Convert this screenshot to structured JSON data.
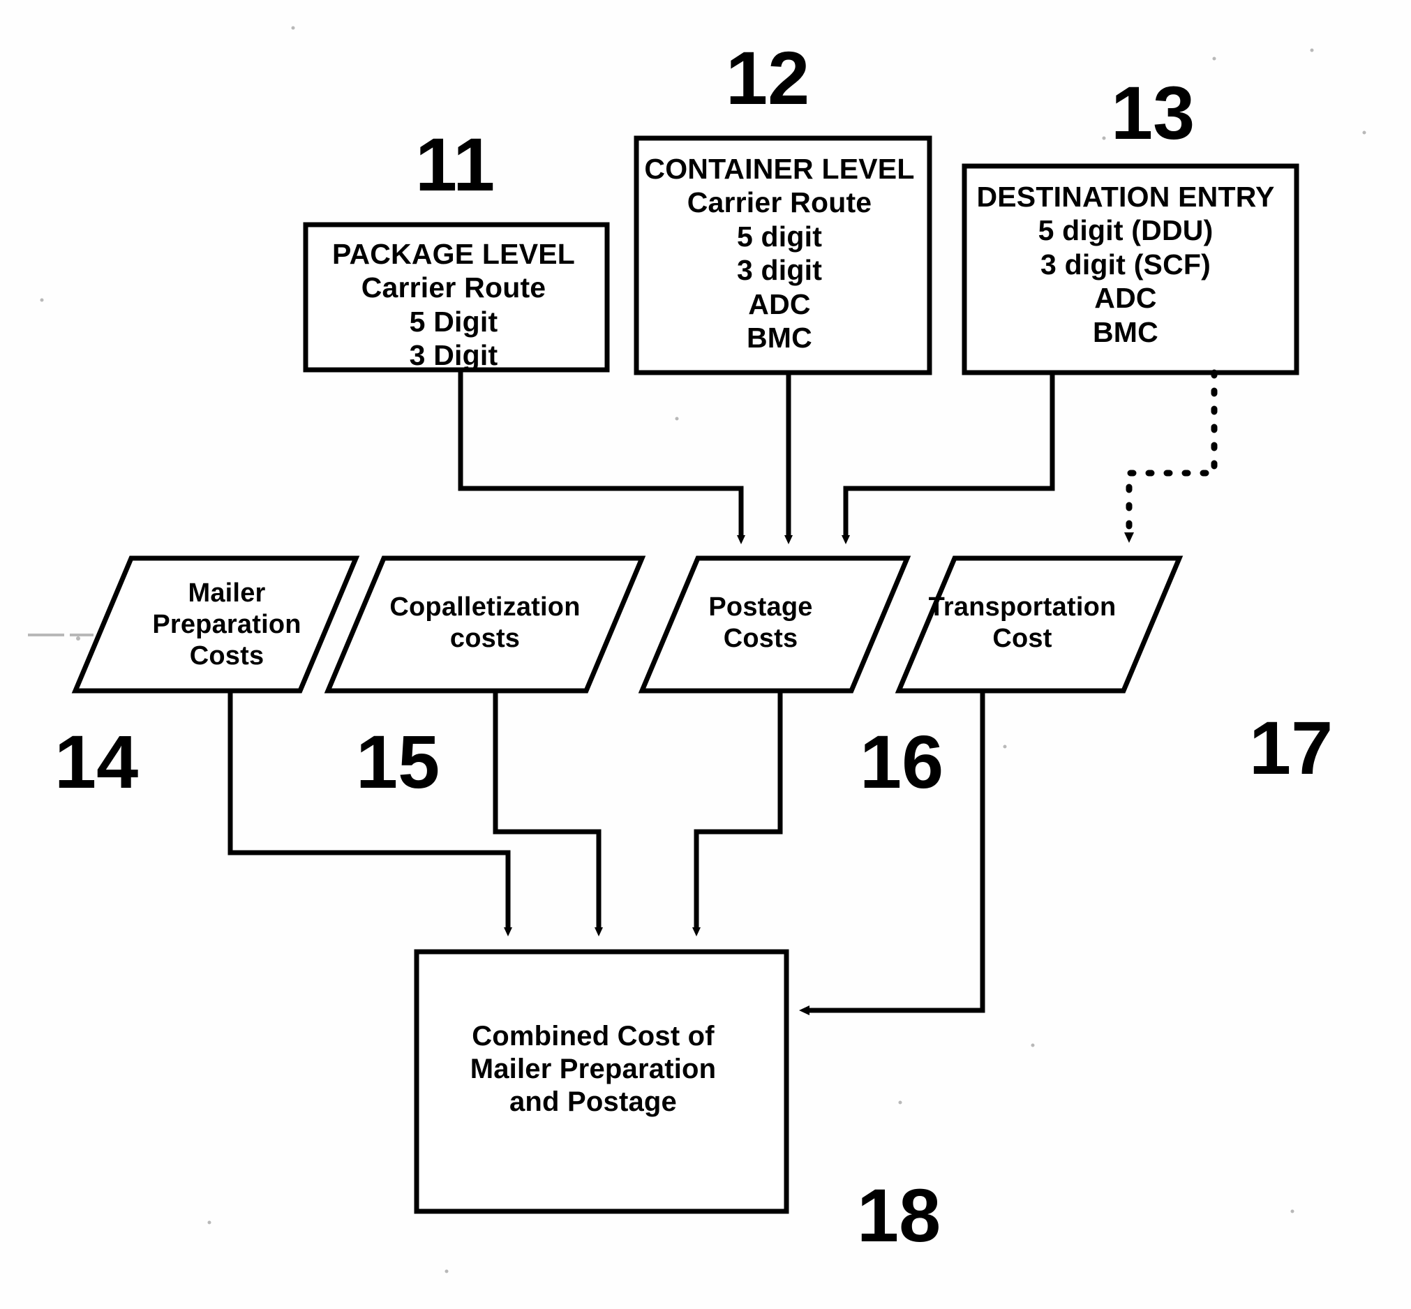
{
  "figure": {
    "type": "patent-flowchart",
    "background_color": "#fefefe",
    "line_color": "#000000"
  },
  "nodes": {
    "package_level": {
      "ref": "11",
      "shape": "rectangle",
      "title": "PACKAGE LEVEL",
      "lines": [
        "Carrier Route",
        "5 Digit",
        "3 Digit"
      ],
      "text": "PACKAGE LEVEL\nCarrier Route\n5 Digit\n3 Digit"
    },
    "container_level": {
      "ref": "12",
      "shape": "rectangle",
      "title": "CONTAINER LEVEL",
      "lines": [
        "Carrier Route",
        "5 digit",
        "3 digit",
        "ADC",
        "BMC"
      ],
      "text": "CONTAINER LEVEL\nCarrier Route\n5 digit\n3 digit\nADC\nBMC"
    },
    "destination_entry": {
      "ref": "13",
      "shape": "rectangle",
      "title": "DESTINATION ENTRY",
      "lines": [
        "5 digit (DDU)",
        "3 digit (SCF)",
        "ADC",
        "BMC"
      ],
      "text": "DESTINATION ENTRY\n5 digit (DDU)\n3 digit (SCF)\nADC\nBMC"
    },
    "mailer_preparation_costs": {
      "ref": "14",
      "shape": "parallelogram",
      "text": "Mailer\nPreparation\nCosts"
    },
    "copalletization_costs": {
      "ref": "15",
      "shape": "parallelogram",
      "text": "Copalletization\ncosts"
    },
    "postage_costs": {
      "ref": "16",
      "shape": "parallelogram",
      "text": "Postage\nCosts"
    },
    "transportation_cost": {
      "ref": "17",
      "shape": "parallelogram",
      "text": "Transportation\nCost"
    },
    "combined_cost": {
      "ref": "18",
      "shape": "rectangle",
      "text": "Combined Cost of\nMailer Preparation\nand Postage"
    }
  },
  "reference_numerals": {
    "n11": "11",
    "n12": "12",
    "n13": "13",
    "n14": "14",
    "n15": "15",
    "n16": "16",
    "n17": "17",
    "n18": "18"
  },
  "connections": [
    {
      "from": "package_level",
      "to": "postage_costs",
      "style": "solid",
      "arrow": true
    },
    {
      "from": "container_level",
      "to": "postage_costs",
      "style": "solid",
      "arrow": true
    },
    {
      "from": "destination_entry",
      "to": "postage_costs",
      "style": "solid",
      "arrow": true
    },
    {
      "from": "destination_entry",
      "to": "transportation_cost",
      "style": "dotted",
      "arrow": true
    },
    {
      "from": "mailer_preparation_costs",
      "to": "combined_cost",
      "style": "solid",
      "arrow": true
    },
    {
      "from": "copalletization_costs",
      "to": "combined_cost",
      "style": "solid",
      "arrow": true
    },
    {
      "from": "postage_costs",
      "to": "combined_cost",
      "style": "solid",
      "arrow": true
    },
    {
      "from": "transportation_cost",
      "to": "combined_cost",
      "style": "solid",
      "arrow": true
    }
  ]
}
